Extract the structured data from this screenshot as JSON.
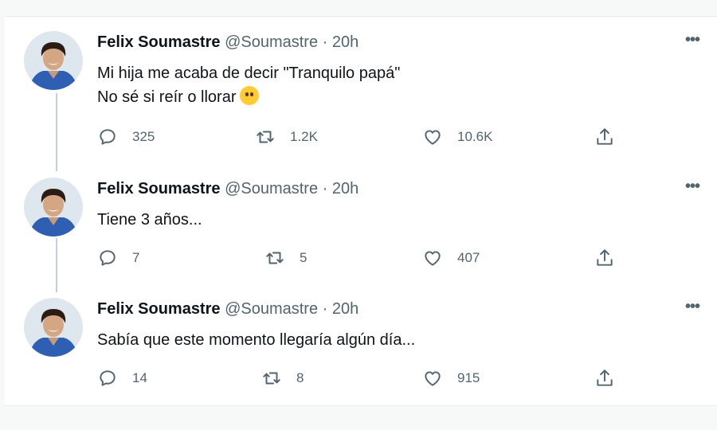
{
  "thread": [
    {
      "author": "Felix Soumastre",
      "handle": "@Soumastre",
      "separator": "·",
      "time": "20h",
      "lines": [
        "Mi hija me acaba de decir \"Tranquilo papá\"",
        "No sé si reír o llorar"
      ],
      "emoji": "no-mouth-face",
      "replies": "325",
      "retweets": "1.2K",
      "likes": "10.6K"
    },
    {
      "author": "Felix Soumastre",
      "handle": "@Soumastre",
      "separator": "·",
      "time": "20h",
      "lines": [
        "Tiene 3 años..."
      ],
      "replies": "7",
      "retweets": "5",
      "likes": "407"
    },
    {
      "author": "Felix Soumastre",
      "handle": "@Soumastre",
      "separator": "·",
      "time": "20h",
      "lines": [
        "Sabía que este momento llegaría algún día..."
      ],
      "replies": "14",
      "retweets": "8",
      "likes": "915"
    }
  ],
  "icons": {
    "more": "more-horizontal-icon",
    "reply": "reply-icon",
    "retweet": "retweet-icon",
    "like": "heart-icon",
    "share": "share-icon"
  },
  "colors": {
    "text": "#0f1419",
    "muted": "#536471",
    "thread_line": "#c4cfd6",
    "background": "#f7f9f9"
  }
}
